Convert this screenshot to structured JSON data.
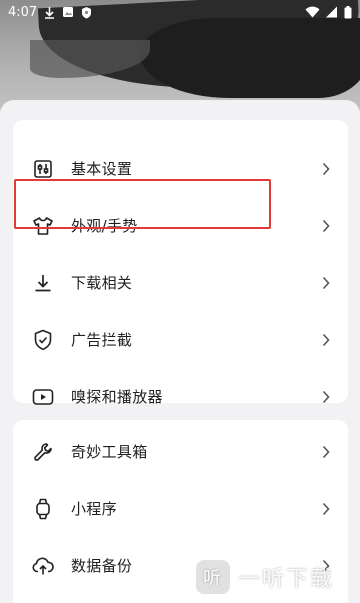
{
  "status_bar": {
    "time": "4:07",
    "left_icons": [
      "download-icon",
      "image-icon",
      "shield-icon"
    ],
    "right_icons": [
      "wifi-icon",
      "signal-icon",
      "battery-icon"
    ]
  },
  "menu_group_1": [
    {
      "label": "基本设置",
      "icon": "sliders-icon"
    },
    {
      "label": "外观/手势",
      "icon": "tshirt-icon",
      "highlighted": true
    },
    {
      "label": "下载相关",
      "icon": "download-icon"
    },
    {
      "label": "广告拦截",
      "icon": "shield-check-icon"
    },
    {
      "label": "嗅探和播放器",
      "icon": "play-icon"
    }
  ],
  "menu_group_2": [
    {
      "label": "奇妙工具箱",
      "icon": "wrench-icon"
    },
    {
      "label": "小程序",
      "icon": "watch-icon"
    },
    {
      "label": "数据备份",
      "icon": "cloud-upload-icon"
    }
  ],
  "watermark": {
    "logo_text": "听",
    "text": "一听下载"
  },
  "colors": {
    "highlight": "#e03a3a",
    "card": "#ffffff",
    "sheet": "#f2f2f4"
  }
}
